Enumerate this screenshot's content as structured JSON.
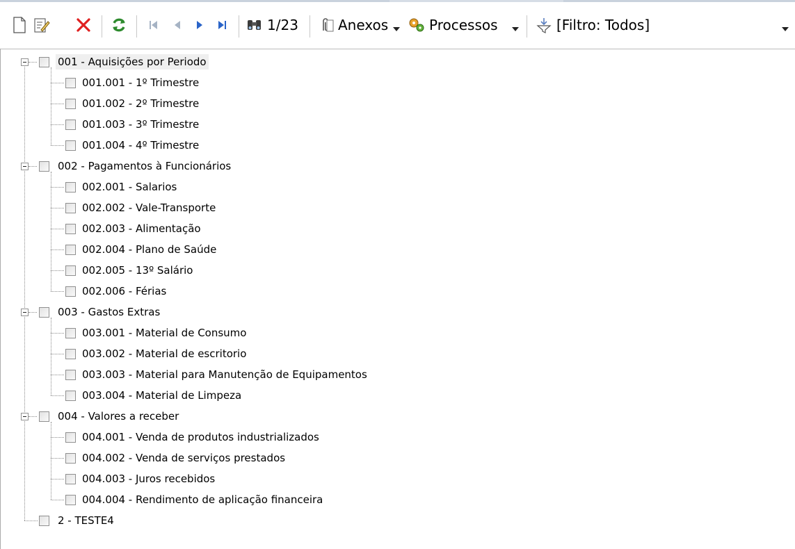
{
  "toolbar": {
    "icons": [
      "new-document-icon",
      "edit-icon",
      "delete-icon",
      "refresh-icon",
      "first-record-icon",
      "previous-record-icon",
      "next-record-icon",
      "last-record-icon",
      "find-icon"
    ],
    "record_counter": "1/23",
    "attachments_label": "Anexos",
    "processes_label": "Processos",
    "filter_label": "[Filtro: Todos]"
  },
  "tree": {
    "groups": [
      {
        "label": "001 - Aquisições por Periodo",
        "children": [
          "001.001 - 1º Trimestre",
          "001.002 - 2º Trimestre",
          "001.003 - 3º Trimestre",
          "001.004 - 4º Trimestre"
        ]
      },
      {
        "label": "002 - Pagamentos à Funcionários",
        "children": [
          "002.001 - Salarios",
          "002.002 - Vale-Transporte",
          "002.003 - Alimentação",
          "002.004 - Plano de Saúde",
          "002.005 - 13º Salário",
          "002.006 - Férias"
        ]
      },
      {
        "label": "003 - Gastos Extras",
        "children": [
          "003.001 - Material de Consumo",
          "003.002 - Material de escritorio",
          "003.003 - Material para Manutenção de Equipamentos",
          "003.004 - Material de Limpeza"
        ]
      },
      {
        "label": "004 - Valores a receber",
        "children": [
          "004.001 - Venda de produtos industrializados",
          "004.002 - Venda de serviços prestados",
          "004.003 - Juros recebidos",
          "004.004 - Rendimento de aplicação financeira"
        ]
      }
    ],
    "last_item": "2 - TESTE4"
  },
  "colors": {
    "delete": "#e02020",
    "refresh": "#2e8b2e",
    "nav_disabled": "#a6b3c4",
    "nav_active": "#2a64c8",
    "tree_lines": "#8a8a8a"
  }
}
